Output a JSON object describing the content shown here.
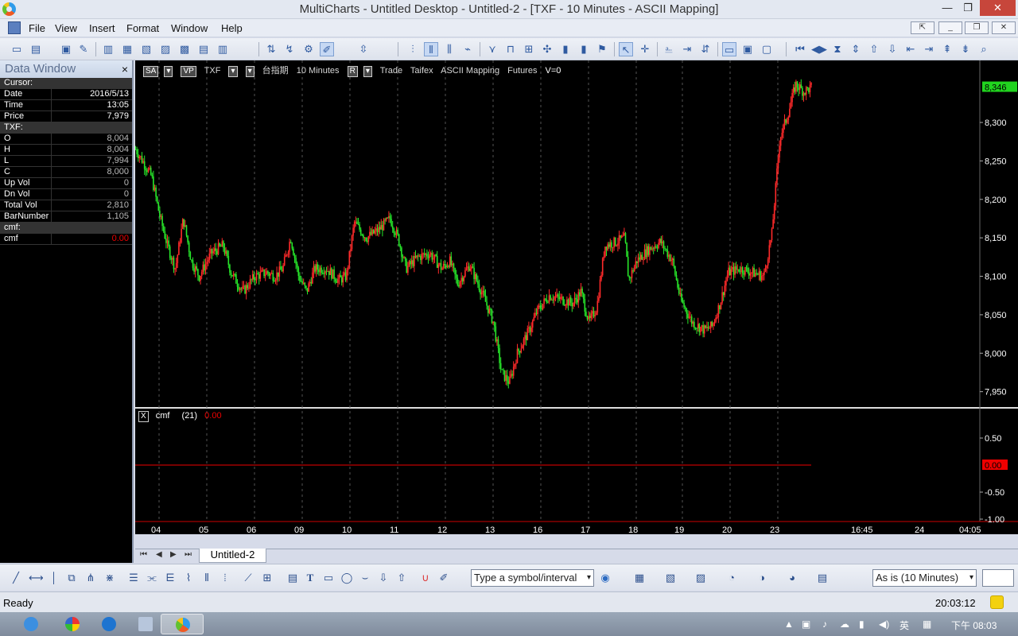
{
  "window": {
    "title": "MultiCharts - Untitled Desktop - Untitled-2 - [TXF - 10 Minutes - ASCII Mapping]"
  },
  "menu": [
    "File",
    "View",
    "Insert",
    "Format",
    "Window",
    "Help"
  ],
  "data_window": {
    "title": "Data Window",
    "rows": [
      {
        "k": "Cursor:",
        "v": "",
        "group": true
      },
      {
        "k": "Date",
        "v": "2016/5/13"
      },
      {
        "k": "Time",
        "v": "13:05"
      },
      {
        "k": "Price",
        "v": "7,979"
      },
      {
        "k": "TXF:",
        "v": "",
        "group": true
      },
      {
        "k": "O",
        "v": "8,004"
      },
      {
        "k": "H",
        "v": "8,004"
      },
      {
        "k": "L",
        "v": "7,994"
      },
      {
        "k": "C",
        "v": "8,000"
      },
      {
        "k": "Up Vol",
        "v": "0"
      },
      {
        "k": "Dn Vol",
        "v": "0"
      },
      {
        "k": "Total Vol",
        "v": "2,810"
      },
      {
        "k": "BarNumber",
        "v": "1,105"
      },
      {
        "k": "cmf:",
        "v": "",
        "group": true
      },
      {
        "k": "cmf",
        "v": "0.00",
        "red": true
      }
    ]
  },
  "chart_header": {
    "sa": "SA",
    "vp": "VP",
    "symbol": "TXF",
    "name": "台指期",
    "interval": "10 Minutes",
    "r": "R",
    "mode": "Trade",
    "exchange": "Taifex",
    "mapping": "ASCII Mapping",
    "category": "Futures",
    "volume": "V=0"
  },
  "indicator": {
    "x": "X",
    "name": "cmf",
    "param": "(21)",
    "value": "0.00"
  },
  "tab": {
    "label": "Untitled-2"
  },
  "drawing_toolbar": {
    "symbol_placeholder": "Type a symbol/interval",
    "resolution": "As is (10 Minutes)"
  },
  "status": {
    "text": "Ready",
    "time": "20:03:12"
  },
  "taskbar": {
    "ime": "英",
    "clock": "下午 08:03"
  },
  "chart_data": {
    "type": "candlestick",
    "title": "",
    "price_axis": {
      "ticks": [
        "8,300",
        "8,250",
        "8,200",
        "8,150",
        "8,100",
        "8,050",
        "8,000",
        "7,950"
      ],
      "range": [
        7930,
        8360
      ]
    },
    "last_price": "8,346",
    "x_ticks": [
      "04",
      "05",
      "06",
      "09",
      "10",
      "11",
      "12",
      "13",
      "16",
      "17",
      "18",
      "19",
      "20",
      "23",
      "16:45",
      "24",
      "04:05"
    ],
    "indicator_axis": {
      "ticks": [
        "0.50",
        "-0.50",
        "-1.00"
      ],
      "value_label": "0.00"
    },
    "price_path": [
      [
        0,
        8265
      ],
      [
        10,
        8248
      ],
      [
        20,
        8230
      ],
      [
        30,
        8180
      ],
      [
        40,
        8140
      ],
      [
        50,
        8110
      ],
      [
        60,
        8175
      ],
      [
        70,
        8120
      ],
      [
        80,
        8100
      ],
      [
        95,
        8130
      ],
      [
        110,
        8140
      ],
      [
        120,
        8105
      ],
      [
        135,
        8080
      ],
      [
        150,
        8100
      ],
      [
        165,
        8105
      ],
      [
        175,
        8100
      ],
      [
        185,
        8110
      ],
      [
        195,
        8150
      ],
      [
        205,
        8100
      ],
      [
        215,
        8080
      ],
      [
        225,
        8110
      ],
      [
        240,
        8110
      ],
      [
        255,
        8095
      ],
      [
        265,
        8100
      ],
      [
        275,
        8170
      ],
      [
        290,
        8150
      ],
      [
        305,
        8160
      ],
      [
        320,
        8175
      ],
      [
        330,
        8150
      ],
      [
        340,
        8110
      ],
      [
        355,
        8125
      ],
      [
        370,
        8130
      ],
      [
        385,
        8110
      ],
      [
        395,
        8120
      ],
      [
        405,
        8090
      ],
      [
        420,
        8115
      ],
      [
        435,
        8080
      ],
      [
        450,
        8040
      ],
      [
        460,
        7975
      ],
      [
        470,
        7962
      ],
      [
        480,
        8000
      ],
      [
        495,
        8030
      ],
      [
        505,
        8055
      ],
      [
        520,
        8075
      ],
      [
        535,
        8070
      ],
      [
        550,
        8065
      ],
      [
        560,
        8080
      ],
      [
        570,
        8040
      ],
      [
        580,
        8060
      ],
      [
        590,
        8140
      ],
      [
        605,
        8145
      ],
      [
        615,
        8150
      ],
      [
        620,
        8095
      ],
      [
        630,
        8120
      ],
      [
        645,
        8135
      ],
      [
        660,
        8145
      ],
      [
        675,
        8120
      ],
      [
        685,
        8070
      ],
      [
        700,
        8040
      ],
      [
        715,
        8030
      ],
      [
        725,
        8035
      ],
      [
        735,
        8065
      ],
      [
        745,
        8105
      ],
      [
        760,
        8110
      ],
      [
        775,
        8105
      ],
      [
        790,
        8100
      ],
      [
        800,
        8155
      ],
      [
        810,
        8280
      ],
      [
        820,
        8310
      ],
      [
        830,
        8350
      ],
      [
        840,
        8340
      ],
      [
        850,
        8346
      ]
    ],
    "cmf_value": 0.0
  }
}
